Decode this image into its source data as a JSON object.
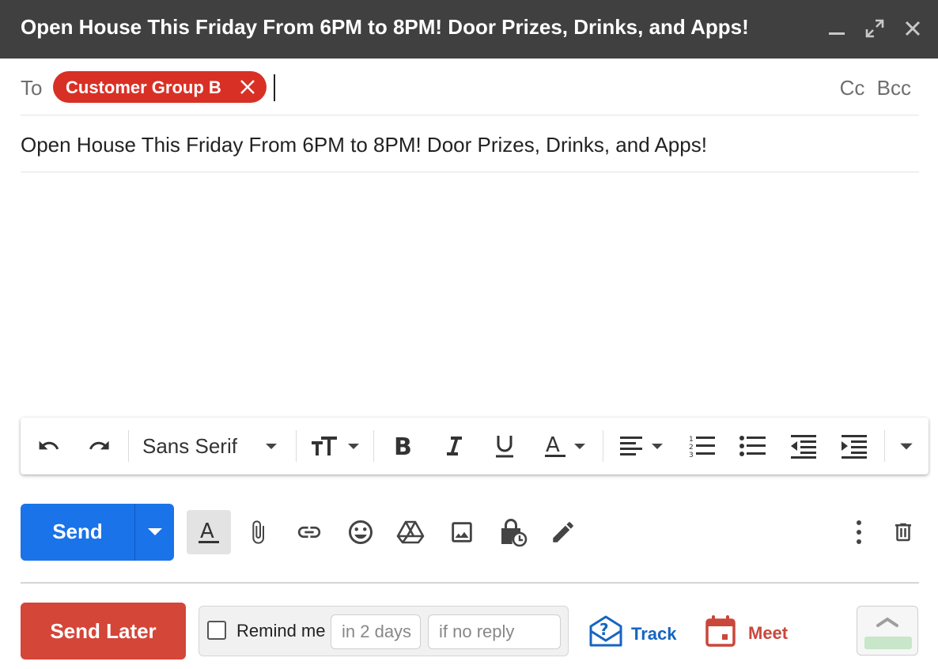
{
  "window": {
    "title": "Open House This Friday From 6PM to 8PM! Door Prizes, Drinks, and Apps!",
    "controls": [
      "minimize-icon",
      "expand-icon",
      "close-icon"
    ]
  },
  "recipients": {
    "to_label": "To",
    "chips": [
      {
        "label": "Customer Group B",
        "remove_icon": "close-icon"
      }
    ],
    "cc_label": "Cc",
    "bcc_label": "Bcc"
  },
  "subject": {
    "value": "Open House This Friday From 6PM to 8PM! Door Prizes, Drinks, and Apps!"
  },
  "body": {
    "value": ""
  },
  "format_toolbar": {
    "font_family": "Sans Serif",
    "buttons": [
      "undo-icon",
      "redo-icon",
      "font-family-select",
      "text-size-icon",
      "bold-icon",
      "italic-icon",
      "underline-icon",
      "text-color-icon",
      "align-icon",
      "numbered-list-icon",
      "bulleted-list-icon",
      "indent-less-icon",
      "indent-more-icon",
      "more-formatting-icon"
    ]
  },
  "compose_actions": {
    "send_label": "Send",
    "icons": [
      "formatting-options-icon",
      "attach-icon",
      "link-icon",
      "emoji-icon",
      "drive-icon",
      "photo-icon",
      "confidential-mode-icon",
      "signature-icon"
    ],
    "right_icons": [
      "more-options-icon",
      "discard-icon"
    ]
  },
  "extension_bar": {
    "send_later_label": "Send Later",
    "remind": {
      "label": "Remind me",
      "checked": false,
      "delay_placeholder": "in 2 days",
      "condition_placeholder": "if no reply"
    },
    "track_label": "Track",
    "meet_label": "Meet",
    "colors": {
      "send": "#1a73e8",
      "send_later": "#d44638",
      "track": "#1565c0",
      "meet": "#c9473b",
      "chip": "#d93025"
    }
  }
}
